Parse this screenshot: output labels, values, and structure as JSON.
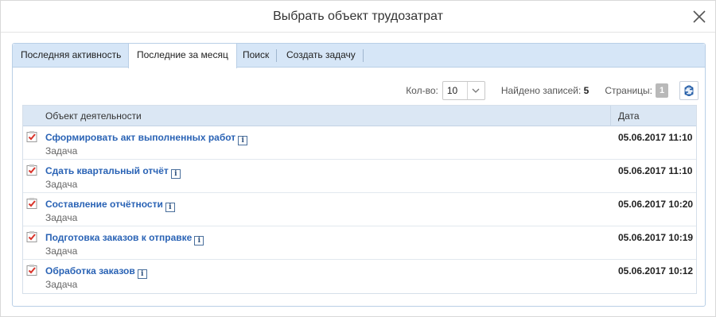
{
  "dialog": {
    "title": "Выбрать объект трудозатрат"
  },
  "tabs": [
    {
      "label": "Последняя активность"
    },
    {
      "label": "Последние за месяц"
    },
    {
      "label": "Поиск"
    },
    {
      "label": "Создать задачу"
    }
  ],
  "toolbar": {
    "qty_label": "Кол-во:",
    "qty_value": "10",
    "found_label": "Найдено записей:",
    "found_count": "5",
    "pages_label": "Страницы:",
    "page_current": "1"
  },
  "grid": {
    "col_object": "Объект деятельности",
    "col_date": "Дата",
    "rows": [
      {
        "title": "Сформировать акт выполненных работ",
        "type": "Задача",
        "date": "05.06.2017 11:10"
      },
      {
        "title": "Сдать квартальный отчёт",
        "type": "Задача",
        "date": "05.06.2017 11:10"
      },
      {
        "title": "Составление отчётности",
        "type": "Задача",
        "date": "05.06.2017 10:20"
      },
      {
        "title": "Подготовка заказов к отправке",
        "type": "Задача",
        "date": "05.06.2017 10:19"
      },
      {
        "title": "Обработка заказов",
        "type": "Задача",
        "date": "05.06.2017 10:12"
      }
    ]
  },
  "icons": {
    "close": "close-icon",
    "dropdown": "chevron-down-icon",
    "refresh": "refresh-icon",
    "task": "task-checkbox-icon",
    "info": "info-icon"
  },
  "colors": {
    "tab_bar": "#d6e6f7",
    "link": "#2a63b5",
    "task_check": "#d9342b",
    "header_row": "#dbe7f4"
  }
}
